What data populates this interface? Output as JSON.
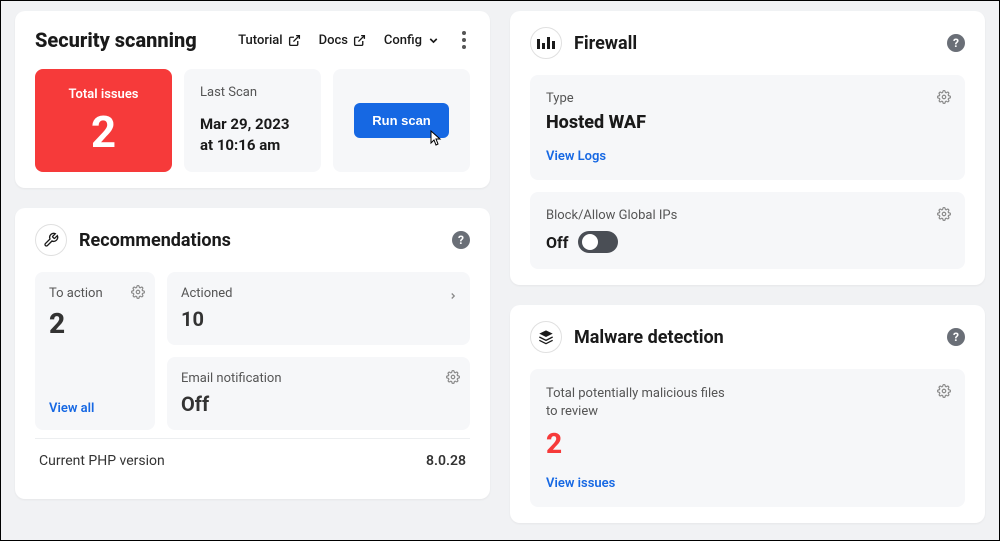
{
  "security": {
    "title": "Security scanning",
    "links": {
      "tutorial": "Tutorial",
      "docs": "Docs",
      "config": "Config"
    },
    "total_issues": {
      "label": "Total issues",
      "value": "2"
    },
    "last_scan": {
      "label": "Last Scan",
      "value": "Mar 29, 2023 at 10:16 am"
    },
    "run_scan": "Run scan"
  },
  "recommendations": {
    "title": "Recommendations",
    "to_action": {
      "label": "To action",
      "value": "2"
    },
    "view_all": "View all",
    "actioned": {
      "label": "Actioned",
      "value": "10"
    },
    "email_notification": {
      "label": "Email notification",
      "value": "Off"
    },
    "php_version": {
      "label": "Current PHP version",
      "value": "8.0.28"
    }
  },
  "firewall": {
    "title": "Firewall",
    "type": {
      "label": "Type",
      "value": "Hosted WAF"
    },
    "view_logs": "View Logs",
    "block_allow": {
      "label": "Block/Allow Global IPs",
      "value": "Off"
    }
  },
  "malware": {
    "title": "Malware detection",
    "files_label": "Total potentially malicious files to review",
    "files_count": "2",
    "view_issues": "View issues"
  }
}
